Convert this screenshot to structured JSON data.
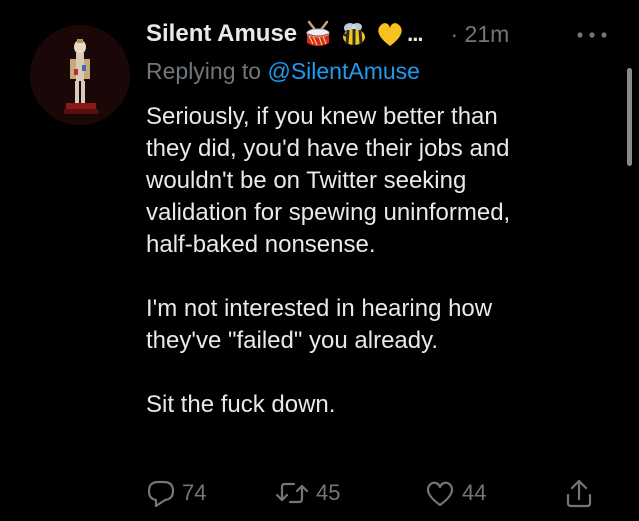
{
  "tweet": {
    "author": {
      "display_name": "Silent Amuse",
      "badges": [
        "drum-emoji",
        "bee-emoji",
        "yellow-heart-emoji"
      ],
      "truncation": "...",
      "timestamp": "· 21m"
    },
    "reply_context": {
      "prefix": "Replying to",
      "handle": "@SilentAmuse"
    },
    "paragraphs": [
      "Seriously, if you knew better than\nthey did, you'd have their jobs and\nwouldn't be on Twitter seeking\nvalidation for spewing uninformed,\nhalf-baked nonsense.",
      "I'm not interested in hearing how\nthey've \"failed\" you already.",
      "Sit the fuck down."
    ],
    "actions": {
      "reply_count": "74",
      "retweet_count": "45",
      "like_count": "44"
    }
  },
  "icons": [
    "avatar",
    "more-icon",
    "reply-icon",
    "retweet-icon",
    "like-icon",
    "share-icon"
  ],
  "colors": {
    "background": "#000000",
    "text": "#e7e9ea",
    "muted": "#71767b",
    "link": "#1d9bf0"
  }
}
